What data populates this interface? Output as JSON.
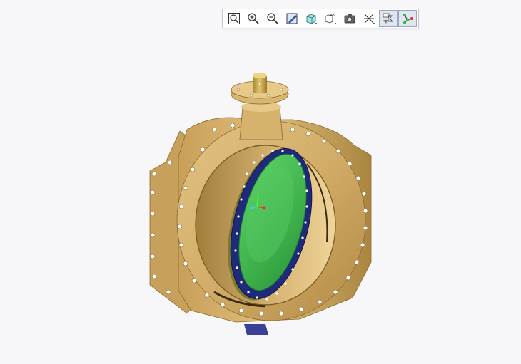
{
  "toolbar": {
    "buttons": [
      {
        "icon": "zoom-fit-icon",
        "active": false
      },
      {
        "icon": "zoom-in-icon",
        "active": false
      },
      {
        "icon": "zoom-out-icon",
        "active": false
      },
      {
        "icon": "repaint-icon",
        "active": false
      },
      {
        "icon": "display-style-icon",
        "active": false
      },
      {
        "icon": "saved-views-icon",
        "active": false,
        "glyph": "AB"
      },
      {
        "icon": "snapshot-icon",
        "active": false
      },
      {
        "icon": "annotation-display-icon",
        "active": false
      },
      {
        "icon": "datum-display-icon",
        "active": true
      },
      {
        "icon": "network-display-icon",
        "active": true
      }
    ]
  },
  "colors": {
    "background": "#f7f7f9",
    "bronze": "#c9a35f",
    "bronze_dark": "#9c7a3c",
    "disc_green": "#39b54a",
    "seal_blue": "#1f2a7a",
    "axis_red": "#ff2a2a",
    "axis_cyan": "#2ad8ff",
    "axis_green": "#39ff3a"
  }
}
